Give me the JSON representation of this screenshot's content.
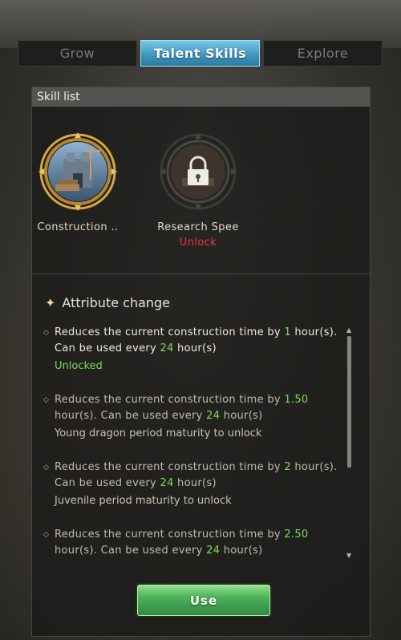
{
  "tabs": [
    {
      "label": "Grow",
      "active": false
    },
    {
      "label": "Talent Skills",
      "active": true
    },
    {
      "label": "Explore",
      "active": false
    }
  ],
  "panel": {
    "header": "Skill list",
    "skills": [
      {
        "name": "Construction ..",
        "status": "",
        "icon": "castle-construction-icon",
        "selected": true
      },
      {
        "name": "Research Spee",
        "status": "Unlock",
        "icon": "lock-icon",
        "selected": false
      }
    ],
    "attribute_title": "Attribute change",
    "entries": [
      {
        "prefix": "Reduces the current construction time by ",
        "hours": "1",
        "middle": " hour(s). Can be used every ",
        "every": "24",
        "suffix": " hour(s)",
        "status": "Unlocked",
        "locked": false
      },
      {
        "prefix": "Reduces the current construction time by ",
        "hours": "1.50",
        "middle": " hour(s). Can be used every ",
        "every": "24",
        "suffix": " hour(s)",
        "status": "Young dragon period maturity to unlock",
        "locked": true
      },
      {
        "prefix": "Reduces the current construction time by ",
        "hours": "2",
        "middle": " hour(s). Can be used every ",
        "every": "24",
        "suffix": " hour(s)",
        "status": "Juvenile period maturity to unlock",
        "locked": true
      },
      {
        "prefix": "Reduces the current construction time by ",
        "hours": "2.50",
        "middle": " hour(s). Can be used every ",
        "every": "24",
        "suffix": " hour(s)",
        "status": "",
        "locked": true
      }
    ],
    "use_label": "Use"
  },
  "colors": {
    "highlight_number": "#7edb5a",
    "unlock_red": "#e63b3b",
    "tab_active": "#4aa3cc",
    "use_button": "#4db05a"
  }
}
